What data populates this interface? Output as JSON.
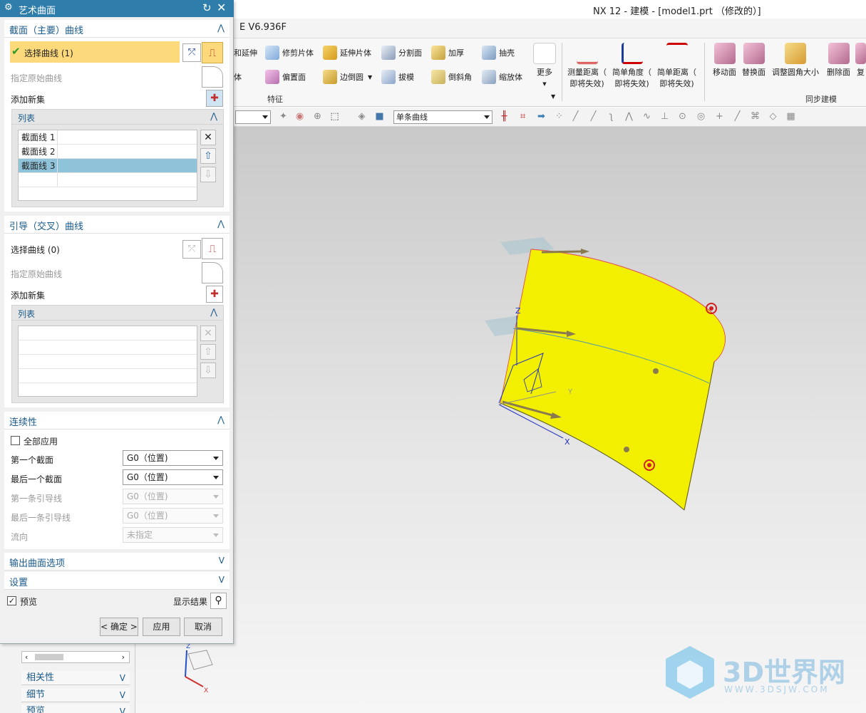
{
  "app": {
    "title": "NX 12 - 建模 - [model1.prt （修改的）]",
    "menu_fragment": "E V6.936F"
  },
  "ribbon": {
    "small_buttons": [
      {
        "label": "和延伸",
        "icon": "extend-icon"
      },
      {
        "label": "体",
        "icon": "body-icon"
      },
      {
        "label": "修剪片体",
        "icon": "trim-sheet-icon"
      },
      {
        "label": "偏置面",
        "icon": "offset-face-icon"
      },
      {
        "label": "延伸片体",
        "icon": "extend-sheet-icon"
      },
      {
        "label": "边倒圆",
        "icon": "edge-blend-icon"
      },
      {
        "label": "分割面",
        "icon": "divide-face-icon"
      },
      {
        "label": "拔模",
        "icon": "draft-icon"
      },
      {
        "label": "加厚",
        "icon": "thicken-icon"
      },
      {
        "label": "倒斜角",
        "icon": "chamfer-icon"
      },
      {
        "label": "抽壳",
        "icon": "shell-icon"
      },
      {
        "label": "缩放体",
        "icon": "scale-body-icon"
      }
    ],
    "more_label": "更多",
    "feature_group_label": "特征",
    "measure_buttons": [
      {
        "line1": "测量距离（",
        "line2": "即将失效)",
        "icon": "measure-distance-icon"
      },
      {
        "line1": "简单角度（",
        "line2": "即将失效)",
        "icon": "simple-angle-icon"
      },
      {
        "line1": "简单距离（",
        "line2": "即将失效)",
        "icon": "simple-distance-icon"
      }
    ],
    "sync_buttons": [
      {
        "label": "移动面",
        "icon": "move-face-icon"
      },
      {
        "label": "替换面",
        "icon": "replace-face-icon"
      },
      {
        "label": "调整圆角大小",
        "icon": "resize-blend-icon"
      },
      {
        "label": "删除面",
        "icon": "delete-face-icon"
      },
      {
        "label": "复",
        "icon": "copy-face-icon"
      }
    ],
    "sync_group_label": "同步建模"
  },
  "filterbar": {
    "curve_rule": "单条曲线"
  },
  "dialog": {
    "title": "艺术曲面",
    "section_curves": {
      "title": "截面（主要）曲线",
      "select_label": "选择曲线 (1)",
      "origin_label": "指定原始曲线",
      "add_new_label": "添加新集",
      "list_title": "列表",
      "rows": [
        "截面线 1",
        "截面线 2",
        "截面线 3"
      ],
      "selected_index": 2
    },
    "guide_curves": {
      "title": "引导（交叉）曲线",
      "select_label": "选择曲线 (0)",
      "origin_label": "指定原始曲线",
      "add_new_label": "添加新集",
      "list_title": "列表"
    },
    "continuity": {
      "title": "连续性",
      "apply_all_label": "全部应用",
      "apply_all_checked": false,
      "first_section_label": "第一个截面",
      "first_section_value": "G0（位置)",
      "last_section_label": "最后一个截面",
      "last_section_value": "G0（位置)",
      "first_guide_label": "第一条引导线",
      "first_guide_value": "G0（位置)",
      "last_guide_label": "最后一条引导线",
      "last_guide_value": "G0（位置)",
      "flow_label": "流向",
      "flow_value": "未指定"
    },
    "output_options_title": "输出曲面选项",
    "settings_title": "设置",
    "preview_label": "预览",
    "preview_checked": true,
    "show_result_label": "显示结果",
    "ok_label": "< 确定 >",
    "apply_label": "应用",
    "cancel_label": "取消"
  },
  "navigator": {
    "sections": [
      "相关性",
      "细节",
      "预览"
    ]
  },
  "viewport": {
    "surface_color": "#f2ef00",
    "axis_labels": {
      "z": "Z",
      "y": "Y",
      "x": "X"
    },
    "triad_labels": {
      "z": "Z",
      "x": "X"
    }
  },
  "watermark": {
    "brand": "3D世界网",
    "url": "WWW.3DSJW.COM"
  }
}
